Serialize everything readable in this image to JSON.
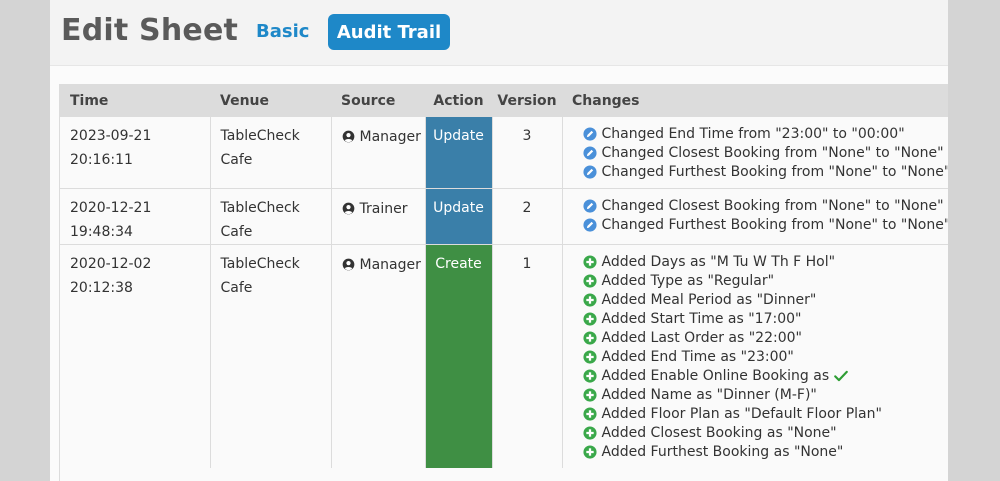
{
  "header": {
    "title": "Edit Sheet",
    "tabs": {
      "basic": "Basic",
      "audit_trail": "Audit Trail"
    }
  },
  "colors": {
    "accent": "#1e88c8",
    "update": "#3a7fa9",
    "create": "#3f8f44",
    "edit_icon": "#4a90d9",
    "add_icon": "#3aa84a",
    "check": "#2e9d34"
  },
  "table": {
    "columns": [
      "Time",
      "Venue",
      "Source",
      "Action",
      "Version",
      "Changes"
    ],
    "rows": [
      {
        "time": [
          "2023-09-21",
          "20:16:11"
        ],
        "venue": [
          "TableCheck",
          "Cafe"
        ],
        "source": "Manager",
        "action": "Update",
        "version": "3",
        "change_icon": "edit-icon",
        "changes": [
          "Changed End Time from \"23:00\" to \"00:00\"",
          "Changed Closest Booking from \"None\" to \"None\"",
          "Changed Furthest Booking from \"None\" to \"None\""
        ]
      },
      {
        "time": [
          "2020-12-21",
          "19:48:34"
        ],
        "venue": [
          "TableCheck",
          "Cafe"
        ],
        "source": "Trainer",
        "action": "Update",
        "version": "2",
        "change_icon": "edit-icon",
        "changes": [
          "Changed Closest Booking from \"None\" to \"None\"",
          "Changed Furthest Booking from \"None\" to \"None\""
        ]
      },
      {
        "time": [
          "2020-12-02",
          "20:12:38"
        ],
        "venue": [
          "TableCheck",
          "Cafe"
        ],
        "source": "Manager",
        "action": "Create",
        "version": "1",
        "change_icon": "plus-circle-icon",
        "changes": [
          "Added Days as \"M Tu W Th F Hol\"",
          "Added Type as \"Regular\"",
          "Added Meal Period as \"Dinner\"",
          "Added Start Time as \"17:00\"",
          "Added Last Order as \"22:00\"",
          "Added End Time as \"23:00\"",
          "Added Enable Online Booking as",
          "Added Name as \"Dinner (M-F)\"",
          "Added Floor Plan as \"Default Floor Plan\"",
          "Added Closest Booking as \"None\"",
          "Added Furthest Booking as \"None\""
        ],
        "checkmark_after_index": 6
      }
    ]
  }
}
